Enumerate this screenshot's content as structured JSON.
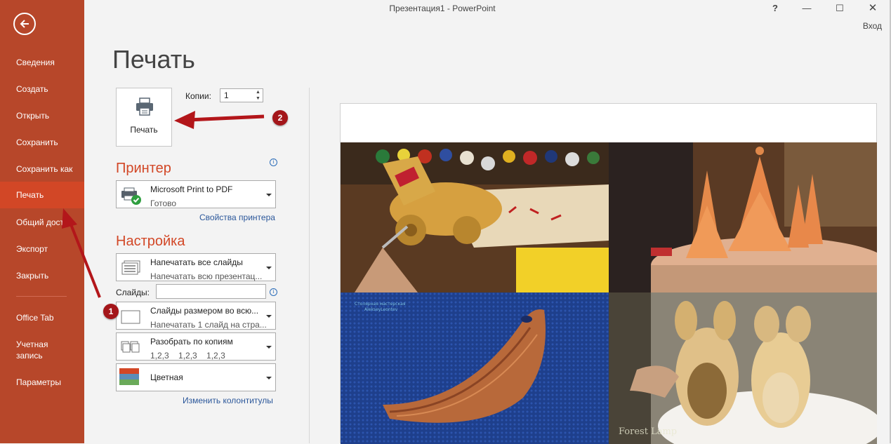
{
  "window": {
    "title": "Презентация1 - PowerPoint",
    "help": "?",
    "minimize": "—",
    "maximize": "☐",
    "close": "✕",
    "signin": "Вход"
  },
  "sidebar": {
    "accent_color": "#b7472a",
    "selected_color": "#d24726",
    "items": [
      {
        "label": "Сведения"
      },
      {
        "label": "Создать"
      },
      {
        "label": "Открыть"
      },
      {
        "label": "Сохранить"
      },
      {
        "label": "Сохранить как"
      },
      {
        "label": "Печать"
      },
      {
        "label": "Общий доступ"
      },
      {
        "label": "Экспорт"
      },
      {
        "label": "Закрыть"
      },
      {
        "label": "Office Tab"
      },
      {
        "label": "Учетная запись"
      },
      {
        "label": "Параметры"
      }
    ],
    "selected": "Печать"
  },
  "print": {
    "heading": "Печать",
    "button_label": "Печать",
    "copies_label": "Копии:",
    "copies_value": "1"
  },
  "printer": {
    "heading": "Принтер",
    "name": "Microsoft Print to PDF",
    "status": "Готово",
    "properties_link": "Свойства принтера"
  },
  "settings": {
    "heading": "Настройка",
    "range": {
      "title": "Напечатать все слайды",
      "subtitle": "Напечатать всю презентац..."
    },
    "slides_label": "Слайды:",
    "slides_value": "",
    "layout": {
      "title": "Слайды размером во всю...",
      "subtitle": "Напечатать 1 слайд на стра..."
    },
    "collate": {
      "title": "Разобрать по копиям",
      "subtitle": "1,2,3    1,2,3    1,2,3"
    },
    "color": {
      "title": "Цветная"
    },
    "footer_link": "Изменить колонтитулы"
  },
  "annotations": {
    "badge1": "1",
    "badge2": "2",
    "arrow_color": "#b3161a"
  },
  "preview": {
    "photos": [
      {
        "name": "wooden-toy-horse"
      },
      {
        "name": "wooden-christmas-trees"
      },
      {
        "name": "wooden-board",
        "watermark_line1": "Столярная мастерская",
        "watermark_line2": "AlekseyLeontev"
      },
      {
        "name": "wooden-pig-figurines",
        "watermark": "Forest Lamp"
      }
    ]
  }
}
